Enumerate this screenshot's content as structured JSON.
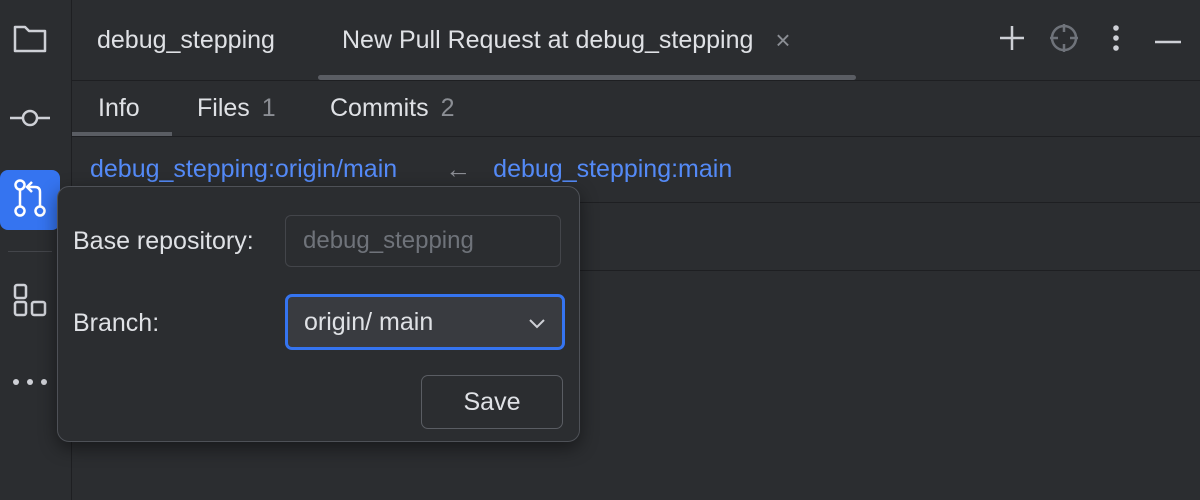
{
  "toolstrip": {
    "items": [
      {
        "icon": "folder-icon"
      },
      {
        "icon": "commit-icon"
      },
      {
        "icon": "pull-request-icon",
        "active": true
      },
      {
        "icon": "structure-icon"
      },
      {
        "icon": "more-icon"
      }
    ]
  },
  "tabs": {
    "first": "debug_stepping",
    "second": "New Pull Request at debug_stepping",
    "close_glyph": "×"
  },
  "subtabs": {
    "info": "Info",
    "files": "Files",
    "files_count": "1",
    "commits": "Commits",
    "commits_count": "2"
  },
  "branches": {
    "target": "debug_stepping:origin/main",
    "arrow": "←",
    "source": "debug_stepping:main"
  },
  "popup": {
    "base_repository_label": "Base repository:",
    "base_repository_value": "debug_stepping",
    "branch_label": "Branch:",
    "branch_value": "origin/ main",
    "save_label": "Save"
  },
  "colors": {
    "accent": "#3574f0",
    "link": "#548af7",
    "background": "#2b2d30"
  }
}
